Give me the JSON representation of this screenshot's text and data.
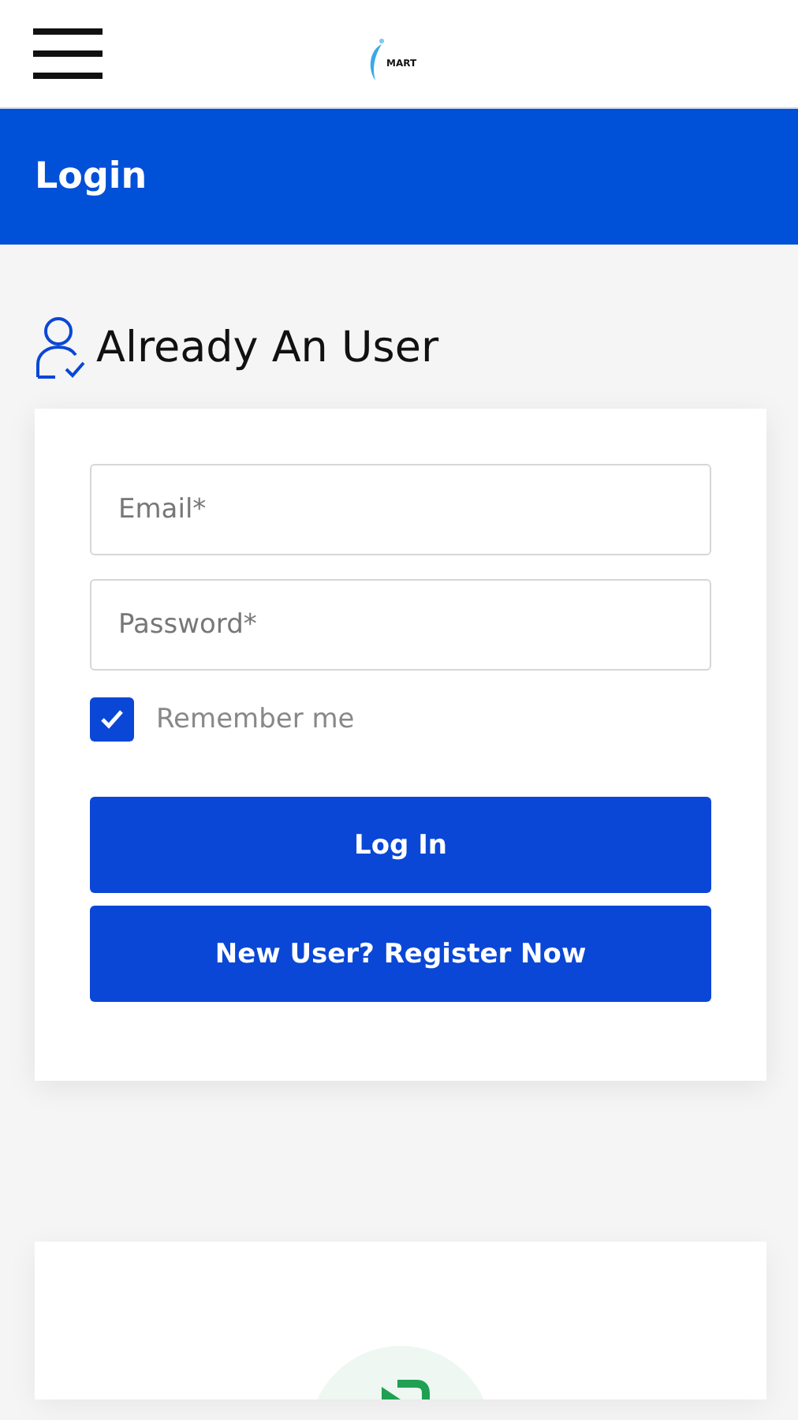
{
  "header": {
    "logo_text": "MART"
  },
  "title_bar": {
    "title": "Login"
  },
  "section": {
    "heading": "Already An User"
  },
  "form": {
    "fields": [
      {
        "placeholder": "Email*"
      },
      {
        "placeholder": "Password*"
      }
    ],
    "remember": {
      "label": "Remember me",
      "checked": true
    },
    "buttons": [
      "Log In",
      "New User? Register Now"
    ]
  }
}
